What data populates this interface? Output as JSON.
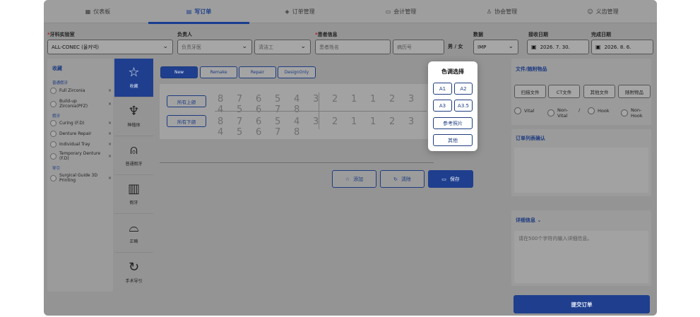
{
  "tabs": [
    {
      "label": "仪表板",
      "icon": "grid-icon"
    },
    {
      "label": "写订单",
      "icon": "document-icon",
      "active": true
    },
    {
      "label": "订单管理",
      "icon": "box-icon"
    },
    {
      "label": "会计管理",
      "icon": "card-icon"
    },
    {
      "label": "协会管理",
      "icon": "person-icon"
    },
    {
      "label": "义齿管理",
      "icon": "smile-icon"
    }
  ],
  "form": {
    "lab": {
      "label": "牙科实验室",
      "value": "ALL-CONEC (올커넥)"
    },
    "manager": {
      "label": "负责人",
      "placeholder1": "负责牙医",
      "placeholder2": "清洁工"
    },
    "patient": {
      "label": "患者信息",
      "name_placeholder": "患者姓名",
      "record_placeholder": "病历号",
      "sex": "男 / 女"
    },
    "data": {
      "label": "数据",
      "value": "IMP"
    },
    "received": {
      "label": "接收日期",
      "value": "2026. 7. 30."
    },
    "completed": {
      "label": "完成日期",
      "value": "2026. 8. 6."
    }
  },
  "favorites": {
    "title": "收藏",
    "groups": [
      {
        "name": "普通假牙",
        "items": [
          "Full Zirconia",
          "Build-up Zirconia(PFZ)"
        ]
      },
      {
        "name": "假牙",
        "items": [
          "Curing (F.D)",
          "Denture Repair",
          "Individual Tray",
          "Temporary Denture (F.D)"
        ]
      },
      {
        "name": "导引",
        "items": [
          "Surgical Guide 3D Printing"
        ]
      }
    ],
    "remove_symbol": "×"
  },
  "categories": [
    {
      "label": "收藏",
      "icon": "star-icon",
      "active": true
    },
    {
      "label": "种植体",
      "icon": "implant-icon"
    },
    {
      "label": "普通假牙",
      "icon": "crown-icon"
    },
    {
      "label": "假牙",
      "icon": "denture-icon"
    },
    {
      "label": "正畸",
      "icon": "orthodontic-icon"
    },
    {
      "label": "手术导引",
      "icon": "surgical-guide-icon"
    }
  ],
  "order_types": [
    "New",
    "Remake",
    "Repair",
    "DesignOnly"
  ],
  "teeth": {
    "upper_all": "所有上颌",
    "lower_all": "所有下颌",
    "digits": "8 7 6 5 4 3 2 1 1 2 3 4 5 6 7 8"
  },
  "actions": {
    "add": "添加",
    "clear": "清除",
    "save": "保存"
  },
  "right": {
    "files_title": "文件/随附物品",
    "file_buttons": [
      "扫描文件",
      "CT文件",
      "其他文件",
      "随附物品"
    ],
    "checks": [
      "Vital",
      "Non-Vital",
      "Hook",
      "Non-Hook"
    ],
    "slash": "/",
    "confirm_title": "订单列表确认",
    "detail_title": "详细信息",
    "detail_placeholder": "请在500个字符内输入详细信息。",
    "submit": "提交订单"
  },
  "shade_popup": {
    "title": "色调选择",
    "shades": [
      "A1",
      "A2",
      "A3",
      "A3.5"
    ],
    "reference": "参考照片",
    "other": "其他"
  },
  "colors": {
    "accent": "#1f3f8e",
    "overlay_gray": "#949494"
  }
}
